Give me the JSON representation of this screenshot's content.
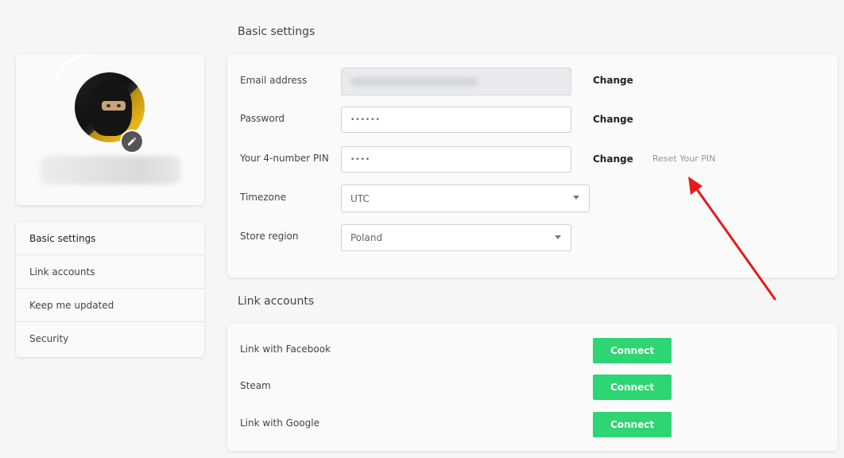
{
  "sections": {
    "basic_title": "Basic settings",
    "link_title": "Link accounts"
  },
  "menu": {
    "items": [
      {
        "label": "Basic settings",
        "active": true
      },
      {
        "label": "Link accounts"
      },
      {
        "label": "Keep me updated"
      },
      {
        "label": "Security"
      }
    ]
  },
  "basic": {
    "email": {
      "label": "Email address",
      "change": "Change"
    },
    "password": {
      "label": "Password",
      "value": "••••••",
      "change": "Change"
    },
    "pin": {
      "label": "Your 4-number PIN",
      "value": "••••",
      "change": "Change",
      "reset": "Reset Your PIN"
    },
    "timezone": {
      "label": "Timezone",
      "value": "UTC"
    },
    "region": {
      "label": "Store region",
      "value": "Poland"
    }
  },
  "link": {
    "facebook": {
      "label": "Link with Facebook",
      "button": "Connect"
    },
    "steam": {
      "label": "Steam",
      "button": "Connect"
    },
    "google": {
      "label": "Link with Google",
      "button": "Connect"
    }
  },
  "colors": {
    "accent": "#2ed573",
    "annotation_arrow": "#e51a1a"
  },
  "icons": {
    "edit": "pencil-icon",
    "select": "chevron-down-icon"
  }
}
